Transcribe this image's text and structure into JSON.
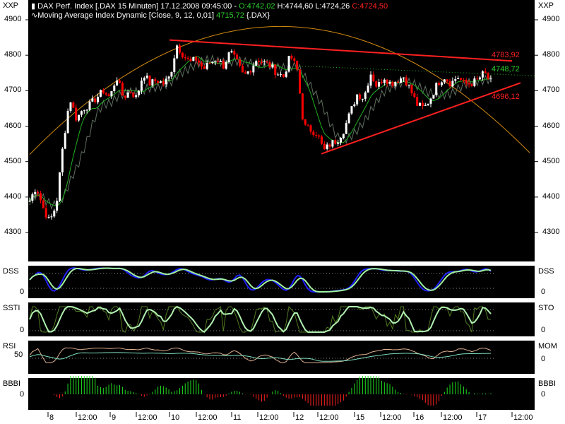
{
  "header": {
    "line1_prefix": "DAX Perf. Index [.DAX  15 Minuten] 17.12.2008 09:45:00 - ",
    "open": "O:4742,02",
    "high": "H:4744,60",
    "low": "L:4724,26",
    "close": "C:4724,50",
    "line2_prefix": "Moving Average Index Dynamic [Close, 9, 12, 0,01] ",
    "ma_value": "4715,72",
    "line2_suffix": " {.DAX}"
  },
  "colors": {
    "up": "#ffffff",
    "down": "#ff0000",
    "trend": "#ff2020",
    "arc": "#d08a10",
    "ma": "#20b020",
    "green_text": "#30d030"
  },
  "chart_data": {
    "type": "candlestick",
    "title": "DAX Perf. Index 15 Minuten",
    "axis_label": "XXP",
    "ylim": [
      4220,
      4955
    ],
    "yticks": [
      "4900",
      "4800",
      "4700",
      "4600",
      "4500",
      "4400",
      "4300"
    ],
    "ytick_values": [
      4900,
      4800,
      4700,
      4600,
      4500,
      4400,
      4300
    ],
    "closes": [
      4390,
      4430,
      4370,
      4330,
      4380,
      4550,
      4680,
      4620,
      4650,
      4660,
      4680,
      4700,
      4680,
      4740,
      4680,
      4700,
      4680,
      4750,
      4720,
      4730,
      4720,
      4740,
      4830,
      4800,
      4780,
      4790,
      4760,
      4780,
      4790,
      4770,
      4810,
      4780,
      4740,
      4760,
      4790,
      4780,
      4770,
      4750,
      4740,
      4800,
      4760,
      4600,
      4590,
      4580,
      4530,
      4550,
      4560,
      4590,
      4640,
      4690,
      4680,
      4750,
      4710,
      4740,
      4720,
      4730,
      4740,
      4700,
      4660,
      4650,
      4680,
      4720,
      4740,
      4720,
      4740,
      4720,
      4720,
      4730,
      4750,
      4724
    ],
    "levels": [
      {
        "label": "4783,92",
        "value": 4783.92,
        "color": "#ff2020"
      },
      {
        "label": "4748,72",
        "value": 4748.72,
        "color": "#30d030"
      },
      {
        "label": "4696,12",
        "value": 4696.12,
        "color": "#ff2020"
      }
    ],
    "xticks": [
      "8",
      "12:00",
      "9",
      "12:00",
      "10",
      "12:00",
      "11",
      "12:00",
      "12",
      "12:00",
      "15",
      "12:00",
      "16",
      "12:00",
      "17",
      "12:00"
    ],
    "panels": [
      {
        "left": "DSS",
        "right": "DSS",
        "zero": "0"
      },
      {
        "left": "SSTI",
        "right": "STO",
        "zero": "0"
      },
      {
        "left": "RSI",
        "left_tick": "50",
        "right": "MOM",
        "zero": "0"
      },
      {
        "left": "BBBI",
        "right": "BBBI",
        "zero": "0"
      }
    ]
  }
}
